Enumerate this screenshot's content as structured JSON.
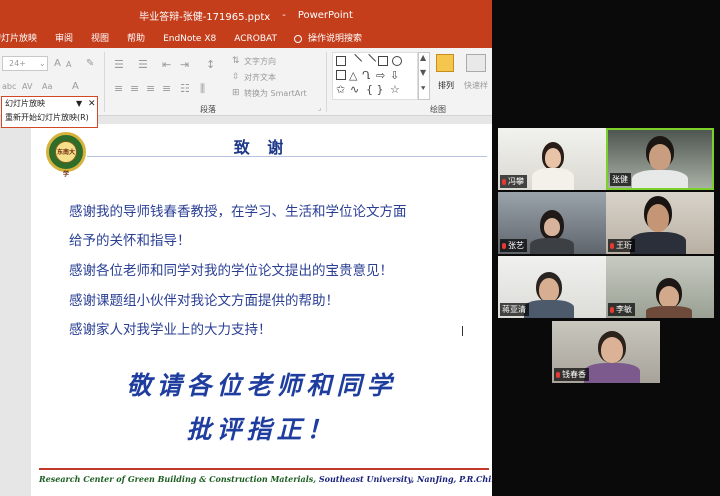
{
  "window": {
    "title": "毕业答辩-张健-171965.pptx",
    "app": "PowerPoint"
  },
  "menu": [
    "幻灯片放映",
    "审阅",
    "视图",
    "帮助",
    "EndNote X8",
    "ACROBAT"
  ],
  "tell_me": "操作说明搜索",
  "ribbon": {
    "font_size": "24+",
    "text_direction": "文字方向",
    "align_text": "对齐文本",
    "smartart": "转换为 SmartArt",
    "arrange": "排列",
    "quick_styles": "快速样",
    "group_paragraph": "段落",
    "group_drawing": "绘图"
  },
  "dropdown": {
    "title": "幻灯片放映",
    "item": "重新开始幻灯片放映(R)"
  },
  "slide": {
    "logo_text": "东南大学",
    "title": "致 谢",
    "lines": [
      "感谢我的导师钱春香教授，在学习、生活和学位论文方面",
      "给予的关怀和指导！",
      "感谢各位老师和同学对我的学位论文提出的宝贵意见！",
      "感谢课题组小伙伴对我论文方面提供的帮助！",
      "感谢家人对我学业上的大力支持！"
    ],
    "closing_1": "敬请各位老师和同学",
    "closing_2": "批评指正！",
    "footer_org": "Research Center of Green Building & Construction Materials,",
    "footer_loc": "Southeast University, NanJing, P.R.China"
  },
  "participants": [
    {
      "name": "冯攀",
      "muted": true
    },
    {
      "name": "张健",
      "muted": false,
      "active": true
    },
    {
      "name": "张艺",
      "muted": true
    },
    {
      "name": "王珩",
      "muted": true
    },
    {
      "name": "蒋亚清",
      "muted": false
    },
    {
      "name": "李敏",
      "muted": true
    },
    {
      "name": "钱春香",
      "muted": true
    }
  ],
  "colors": {
    "accent": "#c43e1c",
    "active_speaker": "#7bd12a",
    "slide_text": "#2a3f94"
  }
}
